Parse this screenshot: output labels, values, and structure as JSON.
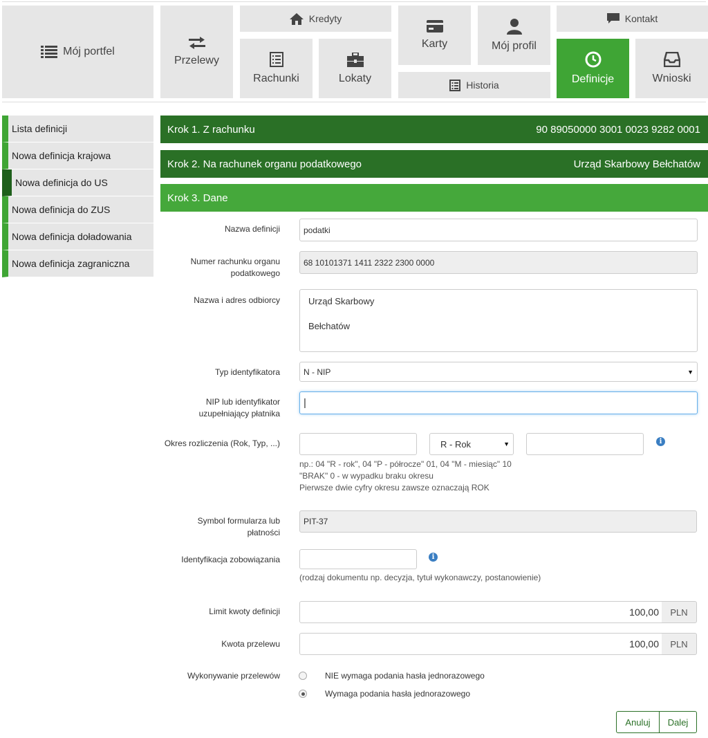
{
  "nav": {
    "portfolio": "Mój portfel",
    "transfers": "Przelewy",
    "loans": "Kredyty",
    "accounts": "Rachunki",
    "deposits": "Lokaty",
    "cards": "Karty",
    "profile": "Mój profil",
    "history": "Historia",
    "contact": "Kontakt",
    "definitions": "Definicje",
    "requests": "Wnioski"
  },
  "sidebar": {
    "items": [
      {
        "label": "Lista definicji"
      },
      {
        "label": "Nowa definicja krajowa"
      },
      {
        "label": "Nowa definicja do US"
      },
      {
        "label": "Nowa definicja do ZUS"
      },
      {
        "label": "Nowa definicja doładowania"
      },
      {
        "label": "Nowa definicja zagraniczna"
      }
    ]
  },
  "steps": {
    "step1": {
      "title": "Krok 1. Z rachunku",
      "value": "90 89050000 3001 0023 9282 0001"
    },
    "step2": {
      "title": "Krok 2. Na rachunek organu podatkowego",
      "value": "Urząd Skarbowy Bełchatów"
    },
    "step3": {
      "title": "Krok 3. Dane"
    }
  },
  "form": {
    "definition_name": {
      "label": "Nazwa definicji",
      "value": "podatki"
    },
    "tax_account": {
      "label_line1": "Numer rachunku organu",
      "label_line2": "podatkowego",
      "value": "68 10101371 1411 2322 2300 0000"
    },
    "recipient": {
      "label": "Nazwa i adres odbiorcy",
      "line1": "Urząd Skarbowy",
      "line2": "Bełchatów"
    },
    "id_type": {
      "label": "Typ identyfikatora",
      "value": "N - NIP"
    },
    "nip": {
      "label_line1": "NIP lub identyfikator",
      "label_line2": "uzupełniający płatnika",
      "value": "|"
    },
    "period": {
      "label": "Okres rozliczenia (Rok, Typ, ...)",
      "type_value": "R - Rok",
      "hint1": "np.: 04 \"R - rok\", 04 \"P - półrocze\" 01, 04 \"M - miesiąc\" 10",
      "hint2": "\"BRAK\" 0 - w wypadku braku okresu",
      "hint3": "Pierwsze dwie cyfry okresu zawsze oznaczają ROK"
    },
    "form_symbol": {
      "label_line1": "Symbol formularza lub",
      "label_line2": "płatności",
      "value": "PIT-37"
    },
    "obligation_id": {
      "label": "Identyfikacja zobowiązania",
      "hint": "(rodzaj dokumentu np. decyzja, tytuł wykonawczy, postanowienie)"
    },
    "limit": {
      "label": "Limit kwoty definicji",
      "value": "100,00",
      "currency": "PLN"
    },
    "amount": {
      "label": "Kwota przelewu",
      "value": "100,00",
      "currency": "PLN"
    },
    "execution": {
      "label": "Wykonywanie przelewów",
      "option1": "NIE wymaga podania hasła jednorazowego",
      "option2": "Wymaga podania hasła jednorazowego",
      "selected": 2
    },
    "info_glyph": "i"
  },
  "buttons": {
    "cancel": "Anuluj",
    "next": "Dalej"
  },
  "colors": {
    "accent": "#45a83b",
    "dark_accent": "#2a7026",
    "tile": "#e6e6e6"
  }
}
